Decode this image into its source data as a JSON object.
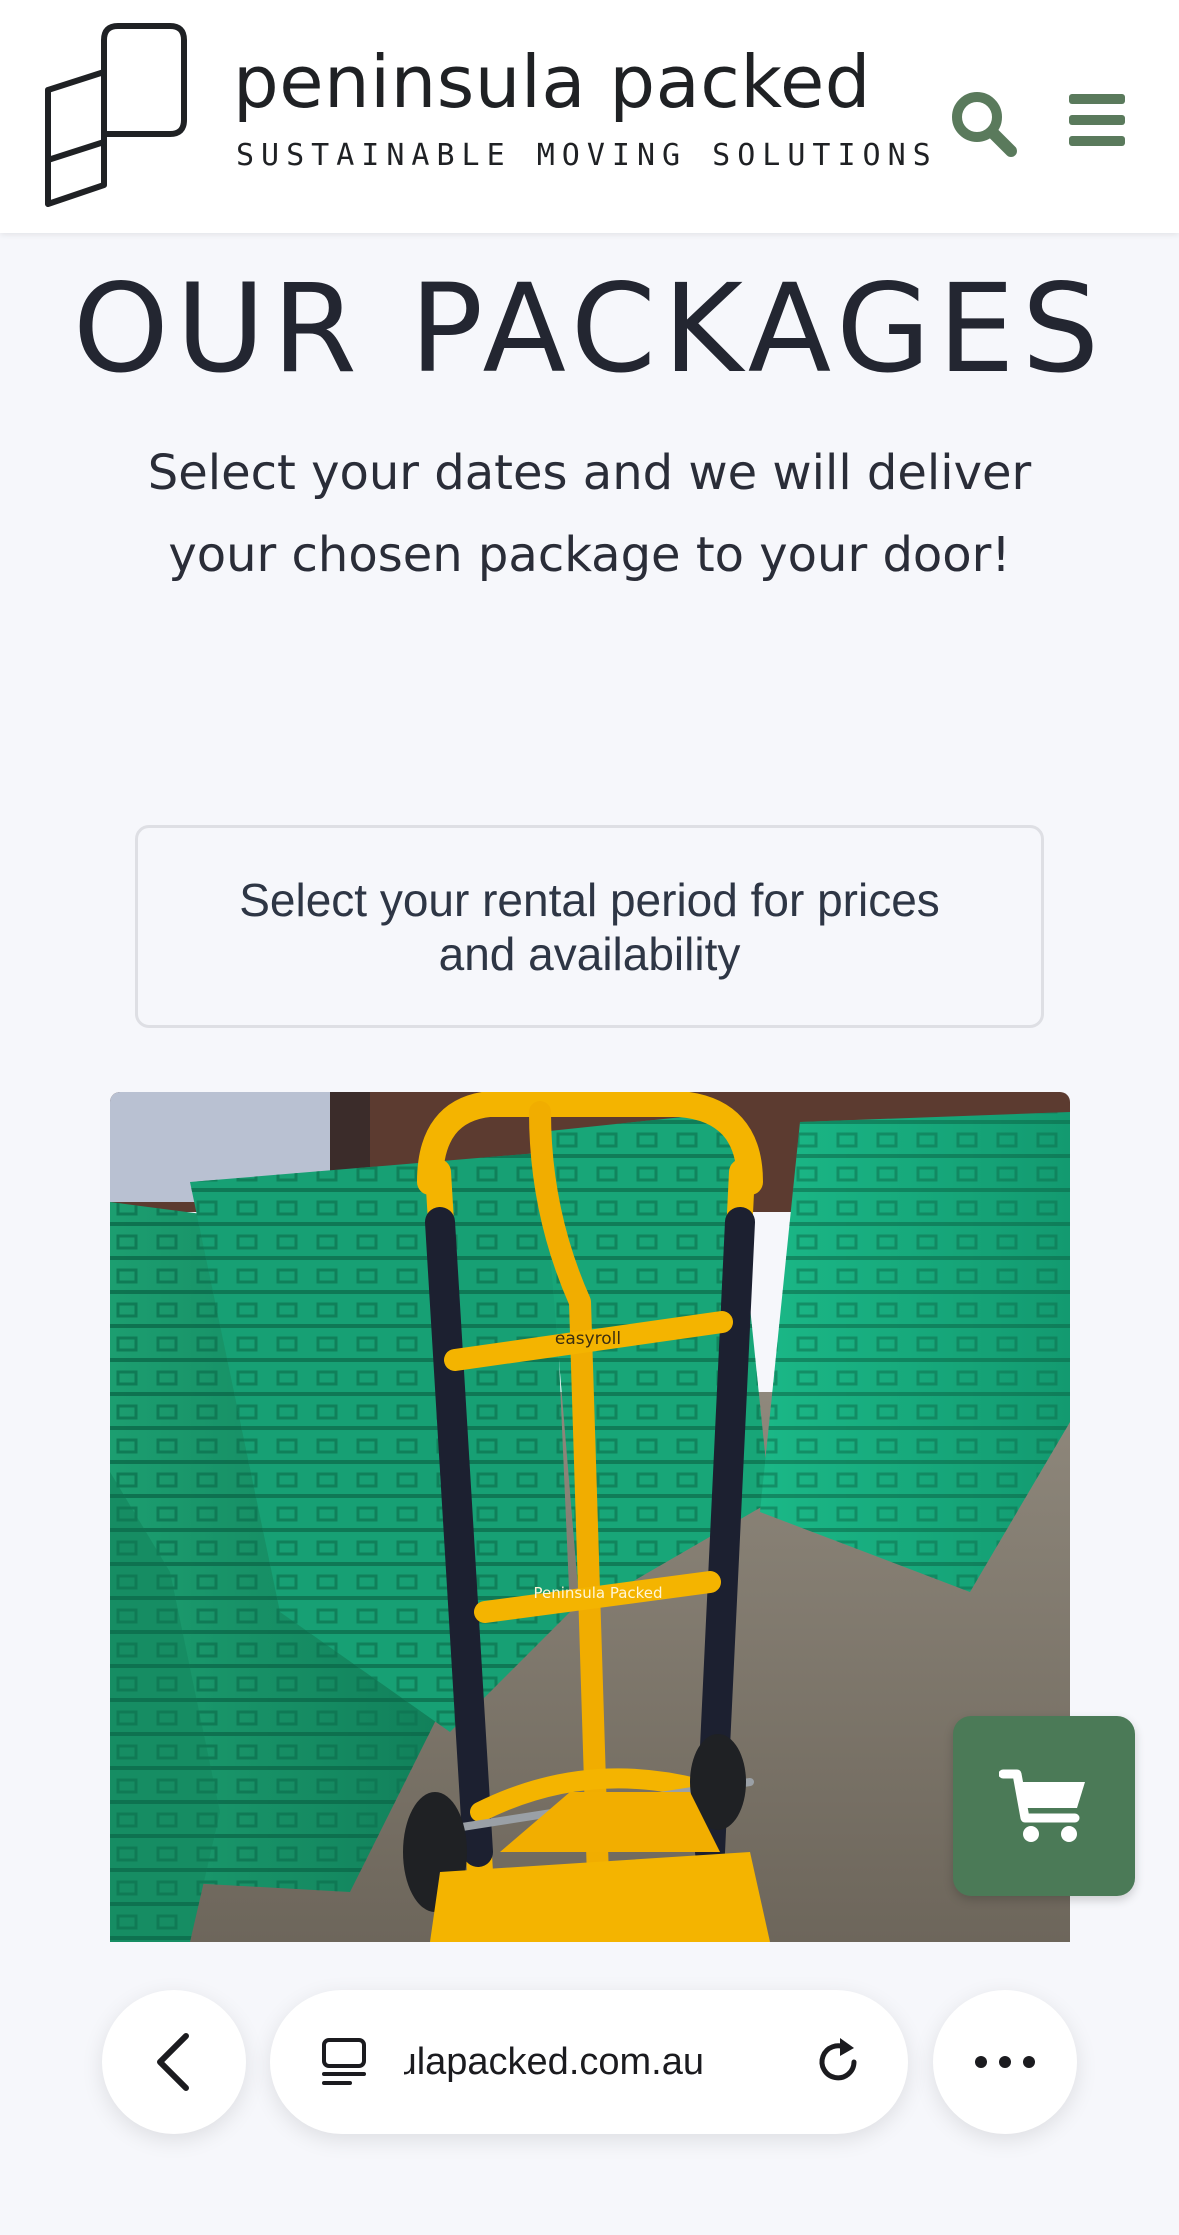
{
  "header": {
    "brand_name": "peninsula packed",
    "tagline": "SUSTAINABLE MOVING SOLUTIONS",
    "icons": {
      "logo": "peninsula-packed-logo",
      "search": "search-icon",
      "menu": "hamburger-menu-icon"
    },
    "accent_color": "#5a7a5c"
  },
  "hero": {
    "title": "OUR PACKAGES",
    "subtitle": "Select your dates and we will deliver your chosen package to your door!"
  },
  "rental": {
    "prompt": "Select your rental period for prices and availability"
  },
  "product": {
    "image_subject": "hand trolley with stacked green moving crates",
    "trolley_brand_text": "easyroll",
    "trolley_label_text": "Peninsula Packed"
  },
  "cart": {
    "icon": "shopping-cart-icon",
    "color": "#4b7a57"
  },
  "browser": {
    "url": "peninsulapacked.com.au",
    "icons": {
      "back": "chevron-left-icon",
      "tabs": "tabs-icon",
      "reload": "reload-icon",
      "more": "more-dots-icon"
    }
  }
}
